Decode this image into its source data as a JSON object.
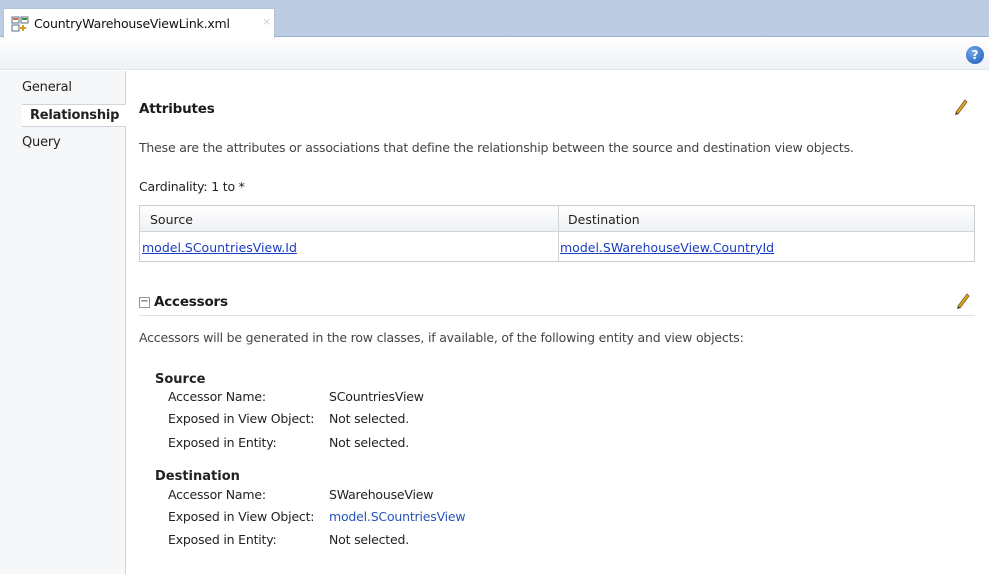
{
  "tab": {
    "title": "CountryWarehouseViewLink.xml",
    "close": "×"
  },
  "toolbar": {
    "help_label": "?"
  },
  "nav": {
    "items": [
      {
        "label": "General"
      },
      {
        "label": "Relationship"
      },
      {
        "label": "Query"
      }
    ]
  },
  "attributes": {
    "heading": "Attributes",
    "description": "These are the attributes or associations that define the relationship between the source and destination view objects.",
    "cardinality": "Cardinality:  1 to *",
    "table": {
      "headers": [
        "Source",
        "Destination"
      ],
      "rows": [
        [
          "model.SCountriesView.Id",
          "model.SWarehouseView.CountryId"
        ]
      ]
    }
  },
  "accessors": {
    "toggle": "−",
    "heading": "Accessors",
    "description": "Accessors will be generated in the row classes, if available, of the following entity and view objects:",
    "source": {
      "title": "Source",
      "accessor_name_label": "Accessor Name:",
      "accessor_name": "SCountriesView",
      "exposed_vo_label": "Exposed in View Object:",
      "exposed_vo": "Not selected.",
      "exposed_entity_label": "Exposed in Entity:",
      "exposed_entity": "Not selected."
    },
    "destination": {
      "title": "Destination",
      "accessor_name_label": "Accessor Name:",
      "accessor_name": "SWarehouseView",
      "exposed_vo_label": "Exposed in View Object:",
      "exposed_vo": "model.SCountriesView",
      "exposed_entity_label": "Exposed in Entity:",
      "exposed_entity": "Not selected."
    }
  }
}
